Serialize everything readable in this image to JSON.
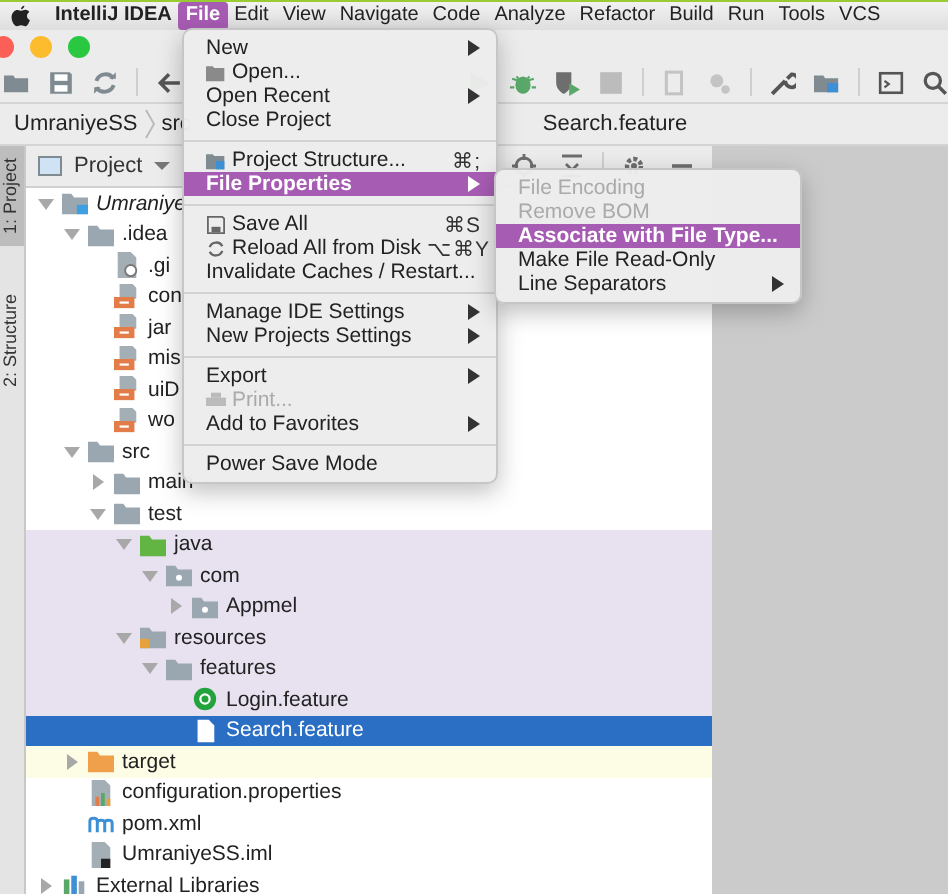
{
  "menubar": [
    {
      "label": "IntelliJ IDEA",
      "kind": "app",
      "selected": false
    },
    {
      "label": "File",
      "kind": "menu",
      "selected": true
    },
    {
      "label": "Edit",
      "kind": "menu",
      "selected": false
    },
    {
      "label": "View",
      "kind": "menu",
      "selected": false
    },
    {
      "label": "Navigate",
      "kind": "menu",
      "selected": false
    },
    {
      "label": "Code",
      "kind": "menu",
      "selected": false
    },
    {
      "label": "Analyze",
      "kind": "menu",
      "selected": false
    },
    {
      "label": "Refactor",
      "kind": "menu",
      "selected": false
    },
    {
      "label": "Build",
      "kind": "menu",
      "selected": false
    },
    {
      "label": "Run",
      "kind": "menu",
      "selected": false
    },
    {
      "label": "Tools",
      "kind": "menu",
      "selected": false
    },
    {
      "label": "VCS",
      "kind": "menu",
      "selected": false
    }
  ],
  "breadcrumbs": [
    "UmraniyeSS",
    "src",
    "Search.feature"
  ],
  "tool_strip": [
    {
      "label": "1: Project",
      "selected": true
    },
    {
      "label": "2: Structure",
      "selected": false
    }
  ],
  "project_panel": {
    "title": "Project"
  },
  "tree": [
    {
      "label": "Umraniye",
      "kind": "module",
      "expanded": true,
      "selected": false,
      "children": [
        {
          "label": ".idea",
          "kind": "folder",
          "expanded": true,
          "selected": false,
          "children": [
            {
              "label": ".gi",
              "kind": "file-git",
              "selected": false
            },
            {
              "label": "con",
              "kind": "file-xml",
              "selected": false
            },
            {
              "label": "jar",
              "kind": "file-xml",
              "selected": false
            },
            {
              "label": "mis",
              "kind": "file-xml",
              "selected": false
            },
            {
              "label": "uiD",
              "kind": "file-xml",
              "selected": false
            },
            {
              "label": "wo",
              "kind": "file-xml",
              "selected": false
            }
          ]
        },
        {
          "label": "src",
          "kind": "folder",
          "expanded": true,
          "selected": false,
          "children": [
            {
              "label": "main",
              "kind": "folder",
              "expanded": false,
              "selected": false
            },
            {
              "label": "test",
              "kind": "folder",
              "expanded": true,
              "selected": false,
              "children": [
                {
                  "label": "java",
                  "kind": "folder-source",
                  "expanded": true,
                  "selected": false,
                  "test_scope": true,
                  "children": [
                    {
                      "label": "com",
                      "kind": "folder-package",
                      "expanded": true,
                      "selected": false,
                      "test_scope": true,
                      "children": [
                        {
                          "label": "Appmel",
                          "kind": "folder-package",
                          "expanded": false,
                          "selected": false,
                          "test_scope": true
                        }
                      ]
                    }
                  ]
                },
                {
                  "label": "resources",
                  "kind": "folder-resources",
                  "expanded": true,
                  "selected": false,
                  "test_scope": true,
                  "children": [
                    {
                      "label": "features",
                      "kind": "folder",
                      "expanded": true,
                      "selected": false,
                      "test_scope": true,
                      "children": [
                        {
                          "label": "Login.feature",
                          "kind": "feature-cucumber",
                          "selected": false,
                          "test_scope": true
                        },
                        {
                          "label": "Search.feature",
                          "kind": "feature",
                          "selected": true
                        }
                      ]
                    }
                  ]
                }
              ]
            }
          ]
        },
        {
          "label": "target",
          "kind": "folder-excluded",
          "expanded": false,
          "selected": false,
          "excluded": true
        },
        {
          "label": "configuration.properties",
          "kind": "properties",
          "selected": false
        },
        {
          "label": "pom.xml",
          "kind": "maven",
          "selected": false
        },
        {
          "label": "UmraniyeSS.iml",
          "kind": "iml",
          "selected": false
        }
      ]
    },
    {
      "label": "External Libraries",
      "kind": "library",
      "expanded": false,
      "selected": false
    }
  ],
  "file_menu": {
    "items": [
      {
        "kind": "item",
        "label": "New",
        "submenu": true,
        "selected": false,
        "disabled": false
      },
      {
        "kind": "item",
        "label": "Open...",
        "selected": false,
        "disabled": false
      },
      {
        "kind": "item",
        "label": "Open Recent",
        "submenu": true,
        "selected": false,
        "disabled": false
      },
      {
        "kind": "item",
        "label": "Close Project",
        "selected": false,
        "disabled": false
      },
      {
        "kind": "separator"
      },
      {
        "kind": "item",
        "label": "Project Structure...",
        "shortcut": "⌘;",
        "selected": false,
        "disabled": false
      },
      {
        "kind": "item",
        "label": "File Properties",
        "submenu": true,
        "selected": true,
        "disabled": false
      },
      {
        "kind": "separator"
      },
      {
        "kind": "item",
        "label": "Save All",
        "shortcut": "⌘S",
        "selected": false,
        "disabled": false
      },
      {
        "kind": "item",
        "label": "Reload All from Disk",
        "shortcut": "⌥⌘Y",
        "selected": false,
        "disabled": false
      },
      {
        "kind": "item",
        "label": "Invalidate Caches / Restart...",
        "selected": false,
        "disabled": false
      },
      {
        "kind": "separator"
      },
      {
        "kind": "item",
        "label": "Manage IDE Settings",
        "submenu": true,
        "selected": false,
        "disabled": false
      },
      {
        "kind": "item",
        "label": "New Projects Settings",
        "submenu": true,
        "selected": false,
        "disabled": false
      },
      {
        "kind": "separator"
      },
      {
        "kind": "item",
        "label": "Export",
        "submenu": true,
        "selected": false,
        "disabled": false
      },
      {
        "kind": "item",
        "label": "Print...",
        "selected": false,
        "disabled": true
      },
      {
        "kind": "item",
        "label": "Add to Favorites",
        "submenu": true,
        "selected": false,
        "disabled": false
      },
      {
        "kind": "separator"
      },
      {
        "kind": "item",
        "label": "Power Save Mode",
        "selected": false,
        "disabled": false
      }
    ]
  },
  "submenu": {
    "items": [
      {
        "kind": "item",
        "label": "File Encoding",
        "selected": false,
        "disabled": true
      },
      {
        "kind": "item",
        "label": "Remove BOM",
        "selected": false,
        "disabled": true
      },
      {
        "kind": "item",
        "label": "Associate with File Type...",
        "selected": true,
        "disabled": false
      },
      {
        "kind": "item",
        "label": "Make File Read-Only",
        "selected": false,
        "disabled": false
      },
      {
        "kind": "item",
        "label": "Line Separators",
        "submenu": true,
        "selected": false,
        "disabled": false
      }
    ]
  }
}
